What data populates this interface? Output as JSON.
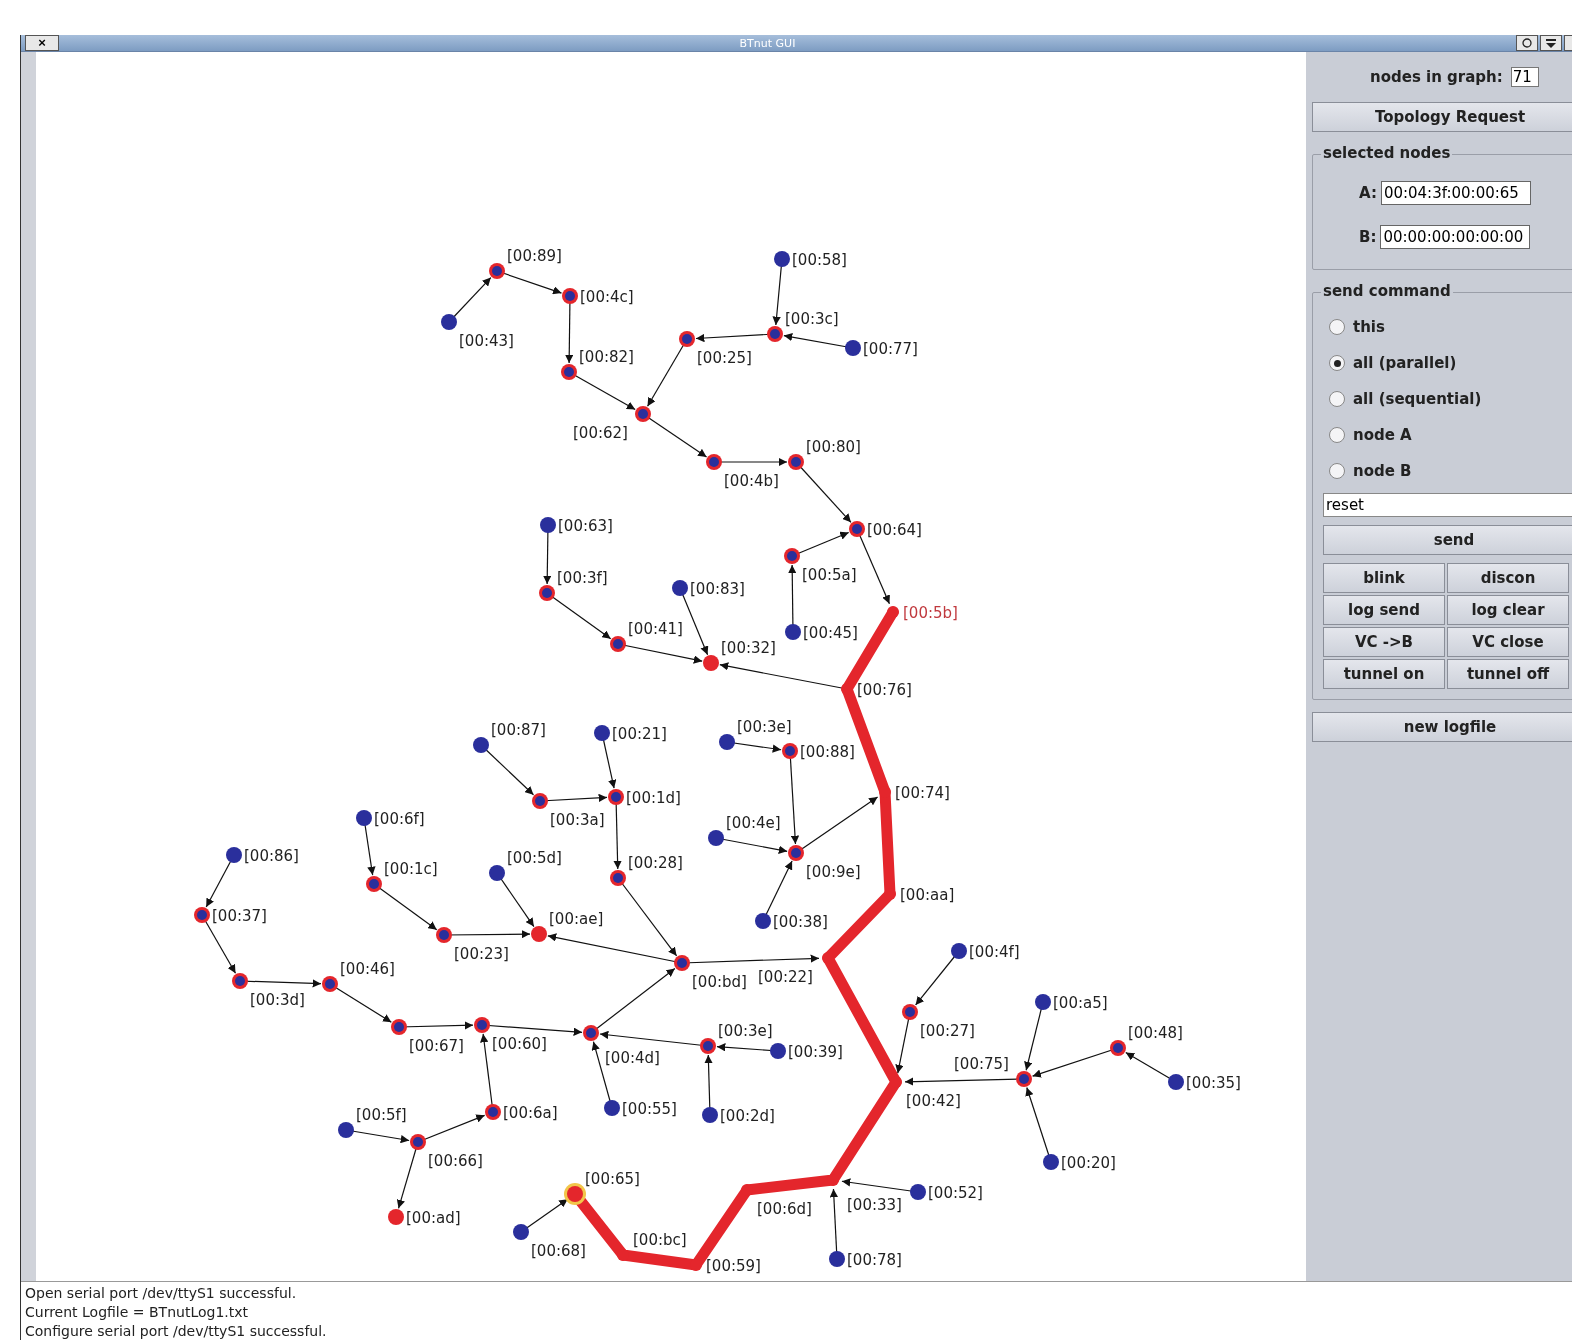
{
  "window": {
    "title": "BTnut GUI",
    "close": "×"
  },
  "graph": {
    "nodes": [
      {
        "label": "[00:89]",
        "kind": "relay"
      },
      {
        "label": "[00:43]",
        "kind": "leaf"
      },
      {
        "label": "[00:4c]",
        "kind": "relay"
      },
      {
        "label": "[00:82]",
        "kind": "relay"
      },
      {
        "label": "[00:58]",
        "kind": "leaf"
      },
      {
        "label": "[00:3c]",
        "kind": "relay"
      },
      {
        "label": "[00:25]",
        "kind": "relay"
      },
      {
        "label": "[00:77]",
        "kind": "leaf"
      },
      {
        "label": "[00:62]",
        "kind": "relay"
      },
      {
        "label": "[00:4b]",
        "kind": "relay"
      },
      {
        "label": "[00:80]",
        "kind": "relay"
      },
      {
        "label": "[00:63]",
        "kind": "leaf"
      },
      {
        "label": "[00:64]",
        "kind": "relay"
      },
      {
        "label": "[00:5a]",
        "kind": "relay"
      },
      {
        "label": "[00:3f]",
        "kind": "relay"
      },
      {
        "label": "[00:83]",
        "kind": "leaf"
      },
      {
        "label": "[00:5b]",
        "kind": "target"
      },
      {
        "label": "[00:45]",
        "kind": "leaf"
      },
      {
        "label": "[00:41]",
        "kind": "relay"
      },
      {
        "label": "[00:32]",
        "kind": "end"
      },
      {
        "label": "[00:76]",
        "kind": "path"
      },
      {
        "label": "[00:87]",
        "kind": "leaf"
      },
      {
        "label": "[00:21]",
        "kind": "leaf"
      },
      {
        "label": "[00:3e]",
        "kind": "leaf"
      },
      {
        "label": "[00:88]",
        "kind": "relay"
      },
      {
        "label": "[00:74]",
        "kind": "path"
      },
      {
        "label": "[00:3a]",
        "kind": "relay"
      },
      {
        "label": "[00:1d]",
        "kind": "relay"
      },
      {
        "label": "[00:6f]",
        "kind": "leaf"
      },
      {
        "label": "[00:4e]",
        "kind": "leaf"
      },
      {
        "label": "[00:9e]",
        "kind": "relay"
      },
      {
        "label": "[00:86]",
        "kind": "leaf"
      },
      {
        "label": "[00:1c]",
        "kind": "relay"
      },
      {
        "label": "[00:5d]",
        "kind": "leaf"
      },
      {
        "label": "[00:28]",
        "kind": "relay"
      },
      {
        "label": "[00:aa]",
        "kind": "path"
      },
      {
        "label": "[00:37]",
        "kind": "relay"
      },
      {
        "label": "[00:38]",
        "kind": "leaf"
      },
      {
        "label": "[00:23]",
        "kind": "relay"
      },
      {
        "label": "[00:ae]",
        "kind": "end"
      },
      {
        "label": "[00:4f]",
        "kind": "leaf"
      },
      {
        "label": "[00:bd]",
        "kind": "relay"
      },
      {
        "label": "[00:22]",
        "kind": "path"
      },
      {
        "label": "[00:3d]",
        "kind": "relay"
      },
      {
        "label": "[00:46]",
        "kind": "relay"
      },
      {
        "label": "[00:a5]",
        "kind": "leaf"
      },
      {
        "label": "[00:27]",
        "kind": "relay"
      },
      {
        "label": "[00:67]",
        "kind": "relay"
      },
      {
        "label": "[00:60]",
        "kind": "relay"
      },
      {
        "label": "[00:4d]",
        "kind": "relay"
      },
      {
        "label": "[00:3e]",
        "kind": "relay"
      },
      {
        "label": "[00:48]",
        "kind": "relay"
      },
      {
        "label": "[00:39]",
        "kind": "leaf"
      },
      {
        "label": "[00:42]",
        "kind": "path"
      },
      {
        "label": "[00:75]",
        "kind": "relay"
      },
      {
        "label": "[00:35]",
        "kind": "leaf"
      },
      {
        "label": "[00:5f]",
        "kind": "leaf"
      },
      {
        "label": "[00:6a]",
        "kind": "relay"
      },
      {
        "label": "[00:55]",
        "kind": "leaf"
      },
      {
        "label": "[00:2d]",
        "kind": "leaf"
      },
      {
        "label": "[00:66]",
        "kind": "relay"
      },
      {
        "label": "[00:20]",
        "kind": "leaf"
      },
      {
        "label": "[00:33]",
        "kind": "path"
      },
      {
        "label": "[00:52]",
        "kind": "leaf"
      },
      {
        "label": "[00:6d]",
        "kind": "path"
      },
      {
        "label": "[00:65]",
        "kind": "selected"
      },
      {
        "label": "[00:ad]",
        "kind": "end"
      },
      {
        "label": "[00:68]",
        "kind": "leaf"
      },
      {
        "label": "[00:78]",
        "kind": "leaf"
      },
      {
        "label": "[00:bc]",
        "kind": "path"
      },
      {
        "label": "[00:59]",
        "kind": "path"
      }
    ]
  },
  "panel": {
    "count_label": "nodes in graph:",
    "count": "71",
    "topology_button": "Topology Request",
    "selected_nodes": {
      "title": "selected nodes",
      "fields": [
        {
          "label": "A:",
          "value": "00:04:3f:00:00:65"
        },
        {
          "label": "B:",
          "value": "00:00:00:00:00:00"
        }
      ]
    },
    "send_command": {
      "title": "send command",
      "options": [
        {
          "label": "this",
          "selected": false
        },
        {
          "label": "all (parallel)",
          "selected": true
        },
        {
          "label": "all (sequential)",
          "selected": false
        },
        {
          "label": "node A",
          "selected": false
        },
        {
          "label": "node B",
          "selected": false
        }
      ],
      "command": "reset",
      "send_button": "send",
      "buttons": [
        "blink",
        "discon",
        "log send",
        "log clear",
        "VC ->B",
        "VC close",
        "tunnel on",
        "tunnel off"
      ]
    },
    "logfile_button": "new logfile"
  },
  "log": {
    "lines": [
      "Open serial port /dev/ttyS1 successful.",
      "Current Logfile = BTnutLog1.txt",
      "Configure serial port /dev/ttyS1 successful."
    ]
  }
}
